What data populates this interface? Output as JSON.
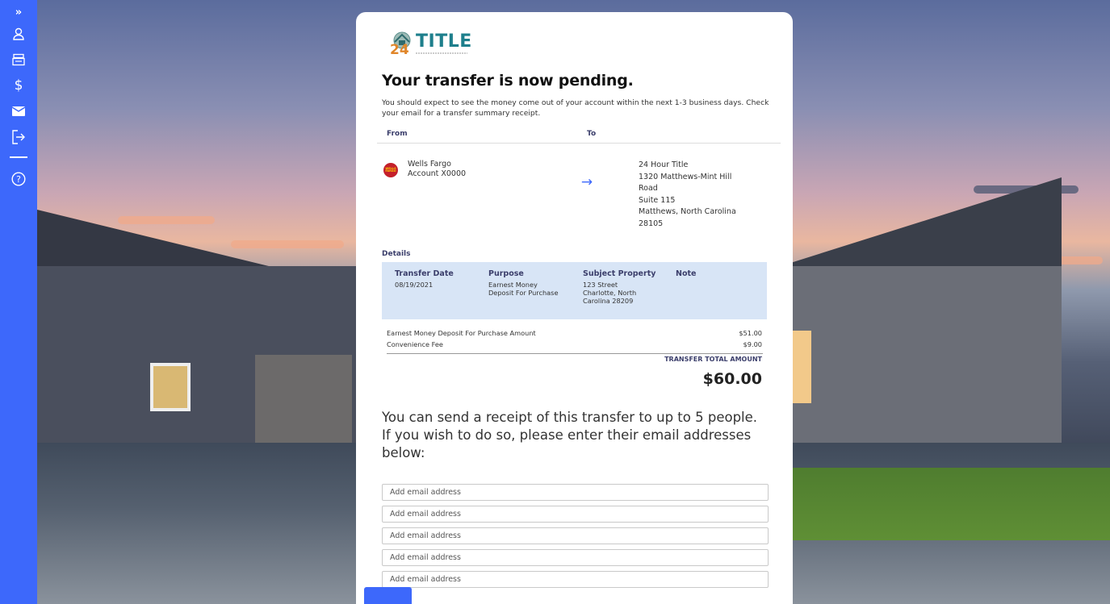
{
  "sidebar": {
    "items": [
      {
        "icon": "user-icon"
      },
      {
        "icon": "register-icon"
      },
      {
        "icon": "dollar-icon"
      },
      {
        "icon": "mail-icon"
      },
      {
        "icon": "logout-icon"
      },
      {
        "icon": "help-icon"
      }
    ]
  },
  "logo": {
    "number": "24",
    "title": "TITLE"
  },
  "heading": "Your transfer is now pending.",
  "intro": "You should expect to see the money come out of your account within the next 1-3 business days. Check your email for a transfer summary receipt.",
  "transfer": {
    "from_label": "From",
    "to_label": "To",
    "from": {
      "bank": "Wells Fargo",
      "account": "Account X0000",
      "logo_text": "WELLS FARGO"
    },
    "to": {
      "name": "24 Hour Title",
      "line1": "1320 Matthews-Mint Hill",
      "line2": "Road",
      "line3": "Suite 115",
      "line4": "Matthews, North Carolina",
      "line5": "28105"
    }
  },
  "details": {
    "label": "Details",
    "transfer_date_label": "Transfer Date",
    "transfer_date": "08/19/2021",
    "purpose_label": "Purpose",
    "purpose_line1": "Earnest Money",
    "purpose_line2": "Deposit For Purchase",
    "property_label": "Subject Property",
    "property_line1": "123 Street",
    "property_line2": "Charlotte, North",
    "property_line3": "Carolina 28209",
    "note_label": "Note"
  },
  "amounts": {
    "deposit_label": "Earnest Money Deposit For Purchase Amount",
    "deposit_value": "$51.00",
    "fee_label": "Convenience Fee",
    "fee_value": "$9.00",
    "total_label": "TRANSFER TOTAL AMOUNT",
    "total_value": "$60.00"
  },
  "receipt": {
    "text": "You can send a receipt of this transfer to up to 5 people. If you wish to do so, please enter their email addresses below:",
    "placeholder": "Add email address"
  }
}
